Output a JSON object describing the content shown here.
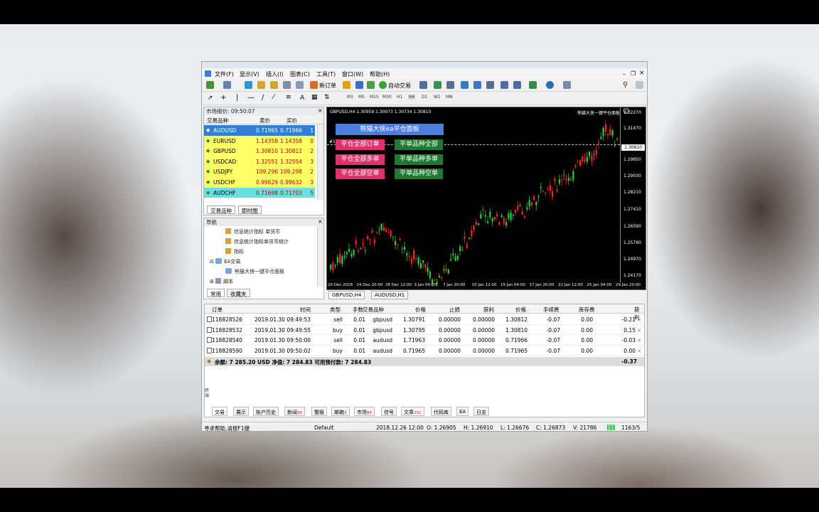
{
  "window": {
    "menu": [
      {
        "label": "文件(F)"
      },
      {
        "label": "显示(V)"
      },
      {
        "label": "插入(I)"
      },
      {
        "label": "图表(C)"
      },
      {
        "label": "工具(T)"
      },
      {
        "label": "窗口(W)"
      },
      {
        "label": "帮助(H)"
      }
    ],
    "toolbar": {
      "new_order": "新订单",
      "auto_trading": "自动交易"
    },
    "timeframes": [
      "M1",
      "M5",
      "M15",
      "M30",
      "H1",
      "H4",
      "D1",
      "W1",
      "MN"
    ]
  },
  "market_watch": {
    "title": "市场报价: 09:50:07",
    "columns": {
      "symbol": "交易品种",
      "bid": "卖价",
      "ask": "买价"
    },
    "rows": [
      {
        "symbol": "AUDUSD",
        "bid": "0.71965",
        "ask": "0.71966",
        "spread": "1",
        "row_color": "#2f7fd6",
        "selected": true
      },
      {
        "symbol": "EURUSD",
        "bid": "1.14358",
        "ask": "1.14358",
        "spread": "0",
        "row_color": "#ffff66"
      },
      {
        "symbol": "GBPUSD",
        "bid": "1.30810",
        "ask": "1.30812",
        "spread": "2",
        "row_color": "#ffff66"
      },
      {
        "symbol": "USDCAD",
        "bid": "1.32551",
        "ask": "1.32554",
        "spread": "3",
        "row_color": "#ffff66"
      },
      {
        "symbol": "USDJPY",
        "bid": "109.296",
        "ask": "109.298",
        "spread": "2",
        "row_color": "#ffff66"
      },
      {
        "symbol": "USDCHF",
        "bid": "0.99629",
        "ask": "0.99632",
        "spread": "3",
        "row_color": "#ffff66"
      },
      {
        "symbol": "AUDCHF",
        "bid": "0.71698",
        "ask": "0.71703",
        "spread": "5",
        "row_color": "#66e0e0"
      }
    ],
    "tabs": [
      "交易品种",
      "即时图"
    ]
  },
  "navigator": {
    "title": "导航",
    "items": [
      {
        "label": "信息统计指标 单货币"
      },
      {
        "label": "信息统计指标单货币统计"
      },
      {
        "label": "指标"
      },
      {
        "label": "EA交易"
      },
      {
        "label": "熊猫大侠一键平仓面板"
      },
      {
        "label": "脚本"
      }
    ],
    "tabs": [
      "常用",
      "收藏夹"
    ]
  },
  "chart": {
    "header": "GBPUSD,H4  1.30959 1.30973 1.30734 1.30810",
    "ea_name": "熊猫大侠一键平仓面板",
    "panel_title": "熊猫大侠ea平仓面板",
    "buttons": [
      {
        "label": "平仓全部订单",
        "color": "#e0306e"
      },
      {
        "label": "平单品种全部",
        "color": "#1f7a2f"
      },
      {
        "label": "平仓全部多单",
        "color": "#e0306e"
      },
      {
        "label": "平单品种多单",
        "color": "#1f7a2f"
      },
      {
        "label": "平仓全部空单",
        "color": "#e0306e"
      },
      {
        "label": "平单品种空单",
        "color": "#1f7a2f"
      }
    ],
    "marker": "#1",
    "price_axis": [
      "1.32270",
      "1.31470",
      "1.30810",
      "1.29850",
      "1.29030",
      "1.28210",
      "1.27410",
      "1.26590",
      "1.25790",
      "1.24970",
      "1.24170"
    ],
    "current_price": "1.30810",
    "time_axis": [
      "20 Dec 2018",
      "24 Dec 20:00",
      "28 Dec 12:00",
      "3 Jan 04:00",
      "7 Jan 20:00",
      "10 Jan 12:00",
      "15 Jan 04:00",
      "17 Jan 20:00",
      "22 Jan 12:00",
      "25 Jan 04:00",
      "29 Jan 20:00"
    ],
    "tabs": [
      "GBPUSD,H4",
      "AUDUSD,H1"
    ]
  },
  "terminal": {
    "columns": {
      "order": "订单",
      "time": "时间",
      "type": "类型",
      "lots": "手数",
      "symbol": "交易品种",
      "price": "价格",
      "sl": "止损",
      "tp": "获利",
      "price2": "价格",
      "commission": "手续费",
      "swap": "库存费",
      "profit": "获利"
    },
    "rows": [
      {
        "order": "118828526",
        "time": "2019.01.30 09:49:53",
        "type": "sell",
        "lots": "0.01",
        "symbol": "gbpusd",
        "price": "1.30791",
        "sl": "0.00000",
        "tp": "0.00000",
        "price2": "1.30812",
        "commission": "-0.07",
        "swap": "0.00",
        "profit": "-0.21"
      },
      {
        "order": "118828532",
        "time": "2019.01.30 09:49:55",
        "type": "buy",
        "lots": "0.01",
        "symbol": "gbpusd",
        "price": "1.30795",
        "sl": "0.00000",
        "tp": "0.00000",
        "price2": "1.30810",
        "commission": "-0.07",
        "swap": "0.00",
        "profit": "0.15"
      },
      {
        "order": "118828540",
        "time": "2019.01.30 09:50:00",
        "type": "sell",
        "lots": "0.01",
        "symbol": "audusd",
        "price": "1.71963",
        "sl": "0.00000",
        "tp": "0.00000",
        "price2": "0.71966",
        "commission": "-0.07",
        "swap": "0.00",
        "profit": "-0.03"
      },
      {
        "order": "118828590",
        "time": "2019.01.30 09:50:02",
        "type": "buy",
        "lots": "0.01",
        "symbol": "audusd",
        "price": "0.71965",
        "sl": "0.00000",
        "tp": "0.00000",
        "price2": "0.71965",
        "commission": "-0.07",
        "swap": "0.00",
        "profit": "0.00"
      }
    ],
    "balance_text": "余额: 7 285.20 USD  净值: 7 284.83  可用预付款: 7 284.83",
    "total_profit": "-0.37",
    "tabs": [
      {
        "label": "交易"
      },
      {
        "label": "展示"
      },
      {
        "label": "账户历史"
      },
      {
        "label": "新闻",
        "count": "99"
      },
      {
        "label": "警报"
      },
      {
        "label": "邮箱",
        "count": "3"
      },
      {
        "label": "市场",
        "count": "95"
      },
      {
        "label": "信号"
      },
      {
        "label": "文章",
        "count": "231"
      },
      {
        "label": "代码库"
      },
      {
        "label": "EA"
      },
      {
        "label": "日志"
      }
    ],
    "side_label": "终端"
  },
  "status": {
    "help": "寻求帮助,请按F1键",
    "profile": "Default",
    "datetime": "2018.12.26 12:00",
    "open": "O: 1.26905",
    "high": "H: 1.26910",
    "low": "L: 1.26676",
    "close": "C: 1.26873",
    "volume": "V: 21786",
    "traffic": "1163/5"
  }
}
